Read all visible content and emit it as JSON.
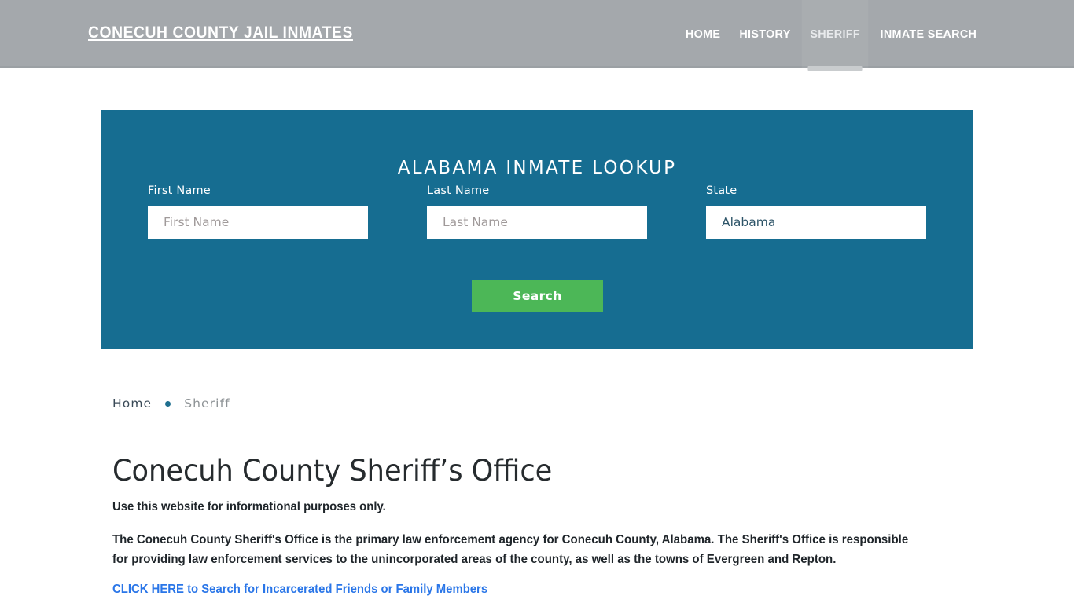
{
  "header": {
    "brand": "CONECUH COUNTY JAIL INMATES",
    "nav": [
      {
        "label": "HOME",
        "active": false
      },
      {
        "label": "HISTORY",
        "active": false
      },
      {
        "label": "SHERIFF",
        "active": true
      },
      {
        "label": "INMATE SEARCH",
        "active": false
      }
    ]
  },
  "lookup": {
    "title": "ALABAMA INMATE LOOKUP",
    "first_name": {
      "label": "First Name",
      "placeholder": "First Name",
      "value": ""
    },
    "last_name": {
      "label": "Last Name",
      "placeholder": "Last Name",
      "value": ""
    },
    "state": {
      "label": "State",
      "placeholder": "State",
      "value": "Alabama"
    },
    "search_button": "Search",
    "panel_color": "#166d91",
    "button_color": "#4cb757"
  },
  "breadcrumb": {
    "home": "Home",
    "separator": "•",
    "current": "Sheriff"
  },
  "content": {
    "title": "Conecuh County Sheriff’s Office",
    "lede": "Use this website for informational purposes only.",
    "paragraph": "The Conecuh County Sheriff's Office is the primary law enforcement agency for Conecuh County, Alabama. The Sheriff's Office is responsible for providing law enforcement services to the unincorporated areas of the county, as well as the towns of Evergreen and Repton.",
    "cta": "CLICK HERE to Search for Incarcerated Friends or Family Members",
    "cta_color": "#2a76e8"
  }
}
